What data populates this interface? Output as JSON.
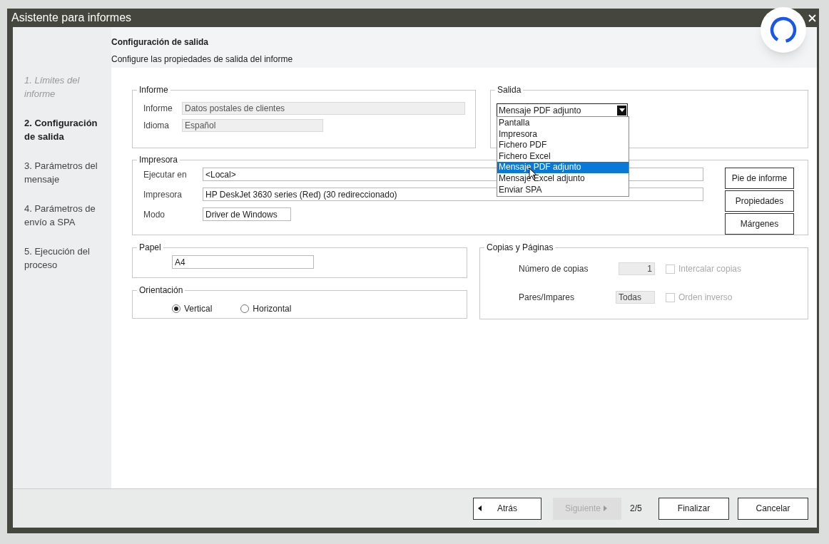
{
  "window": {
    "title": "Asistente para informes",
    "close_visible": true
  },
  "header": {
    "title": "Configuración de salida",
    "subtitle": "Configure las propiedades de salida del informe"
  },
  "steps": [
    {
      "label": "1. Límites del informe",
      "done": true,
      "selected": false
    },
    {
      "label": "2. Configuración de salida",
      "done": false,
      "selected": true
    },
    {
      "label": "3. Parámetros del mensaje",
      "done": false,
      "selected": false
    },
    {
      "label": "4. Parámetros de envío a SPA",
      "done": false,
      "selected": false
    },
    {
      "label": "5. Ejecución del proceso",
      "done": false,
      "selected": false
    }
  ],
  "informe": {
    "title": "Informe",
    "fields": [
      {
        "label": "Informe",
        "value": "Datos postales de clientes",
        "readonly": true
      },
      {
        "label": "Idioma",
        "value": "Español",
        "readonly": true
      }
    ]
  },
  "salida": {
    "title": "Salida",
    "value": "Mensaje PDF adjunto",
    "expanded": true,
    "options": [
      {
        "label": "Pantalla",
        "selected": false
      },
      {
        "label": "Impresora",
        "selected": false
      },
      {
        "label": "Fichero PDF",
        "selected": false
      },
      {
        "label": "Fichero Excel",
        "selected": false
      },
      {
        "label": "Mensaje PDF adjunto",
        "selected": true
      },
      {
        "label": "Mensaje Excel adjunto",
        "selected": false
      },
      {
        "label": "Enviar SPA",
        "selected": false
      }
    ]
  },
  "impresora": {
    "title": "Impresora",
    "fields": [
      {
        "label": "Ejecutar en",
        "value": "<Local>"
      },
      {
        "label": "Impresora",
        "value": "HP DeskJet 3630 series (Red) (30 redireccionado)"
      },
      {
        "label": "Modo",
        "value": "Driver de Windows"
      }
    ],
    "buttons": [
      "Pie de informe",
      "Propiedades",
      "Márgenes"
    ]
  },
  "papel": {
    "title": "Papel",
    "value": "A4"
  },
  "orientacion": {
    "title": "Orientación",
    "options": [
      {
        "label": "Vertical",
        "selected": true
      },
      {
        "label": "Horizontal",
        "selected": false
      }
    ]
  },
  "copias": {
    "title": "Copias y Páginas",
    "rows": [
      {
        "label": "Número de copias",
        "value": "1",
        "checkbox": {
          "label": "Intercalar copias",
          "checked": false,
          "disabled": true
        }
      },
      {
        "label": "Pares/Impares",
        "value": "Todas",
        "checkbox": {
          "label": "Orden inverso",
          "checked": false,
          "disabled": true
        }
      }
    ]
  },
  "footer": {
    "back": {
      "label": "Atrás",
      "disabled": false
    },
    "next": {
      "label": "Siguiente",
      "disabled": true
    },
    "page": "2/5",
    "finish": "Finalizar",
    "cancel": "Cancelar"
  }
}
